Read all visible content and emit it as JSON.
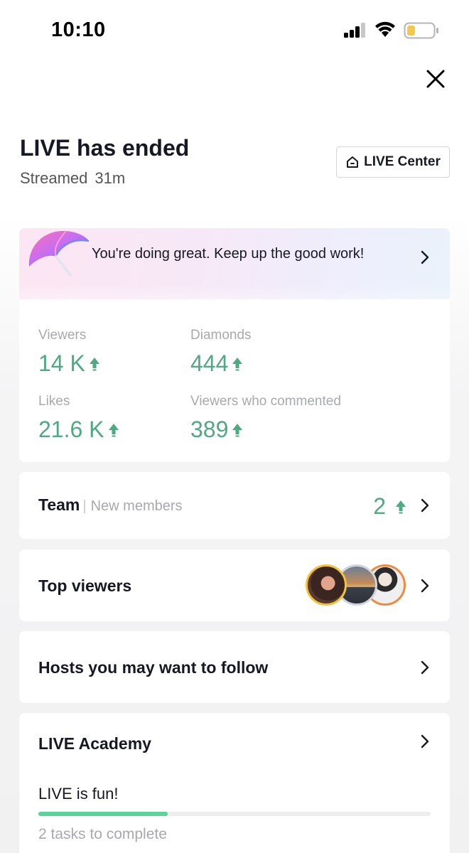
{
  "status_bar": {
    "time": "10:10",
    "icons": [
      "signal-icon",
      "wifi-icon",
      "battery-icon"
    ],
    "battery_color": "#f2c94c"
  },
  "header": {
    "title": "LIVE has ended",
    "streamed_label": "Streamed",
    "streamed_duration": "31m",
    "live_center_label": "LIVE Center",
    "live_center_icon": "home-icon",
    "close_icon": "close-icon"
  },
  "banner": {
    "text": "You're doing great. Keep up the good work!",
    "icon": "umbrella-icon"
  },
  "stats": [
    {
      "label": "Viewers",
      "value": "14 K",
      "trend": "up"
    },
    {
      "label": "Diamonds",
      "value": "444",
      "trend": "up"
    },
    {
      "label": "Likes",
      "value": "21.6 K",
      "trend": "up"
    },
    {
      "label": "Viewers who commented",
      "value": "389",
      "trend": "up"
    }
  ],
  "team": {
    "title": "Team",
    "subtitle": "New members",
    "count": "2",
    "trend": "up"
  },
  "top_viewers": {
    "title": "Top viewers",
    "avatar_count": 3
  },
  "hosts": {
    "title": "Hosts you may want to follow"
  },
  "academy": {
    "title": "LIVE Academy",
    "subtitle": "LIVE is fun!",
    "tasks": "2 tasks to complete",
    "progress": 0.33
  },
  "colors": {
    "accent_green": "#4fa982",
    "progress_green": "#5bd49a",
    "muted_text": "#a7a9ae"
  }
}
